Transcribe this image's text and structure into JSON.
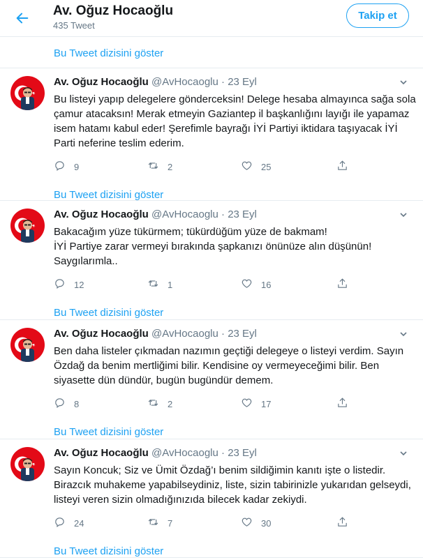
{
  "header": {
    "name": "Av. Oğuz Hocaoğlu",
    "tweet_count": "435 Tweet",
    "follow_label": "Takip et"
  },
  "thread_link_label": "Bu Tweet dizisini göster",
  "tweets": [
    {
      "name": "Av. Oğuz Hocaoğlu",
      "handle": "@AvHocaoglu",
      "separator": "·",
      "date": "23 Eyl",
      "lines": [
        "Bu listeyi yapıp delegelere gönderceksin! Delege hesaba almayınca sağa sola",
        "çamur atacaksın! Merak etmeyin Gaziantep il başkanlığını layığı ile yapamaz",
        "isem hatamı kabul eder! Şerefimle bayrağı İYİ Partiyi iktidara taşıyacak İYİ",
        "Parti neferine teslim ederim."
      ],
      "replies": "9",
      "retweets": "2",
      "likes": "25"
    },
    {
      "name": "Av. Oğuz Hocaoğlu",
      "handle": "@AvHocaoglu",
      "separator": "·",
      "date": "23 Eyl",
      "lines": [
        "Bakacağım yüze tükürmem; tükürdüğüm yüze de bakmam!",
        "İYİ Partiye zarar vermeyi bırakında şapkanızı önünüze alın düşünün!",
        "Saygılarımla.."
      ],
      "replies": "12",
      "retweets": "1",
      "likes": "16"
    },
    {
      "name": "Av. Oğuz Hocaoğlu",
      "handle": "@AvHocaoglu",
      "separator": "·",
      "date": "23 Eyl",
      "lines": [
        "Ben daha listeler çıkmadan nazımın geçtiği delegeye o listeyi verdim. Sayın",
        "Özdağ da benim mertliğimi bilir. Kendisine oy vermeyeceğimi bilir. Ben",
        "siyasette dün dündür, bugün bugündür demem."
      ],
      "replies": "8",
      "retweets": "2",
      "likes": "17"
    },
    {
      "name": "Av. Oğuz Hocaoğlu",
      "handle": "@AvHocaoglu",
      "separator": "·",
      "date": "23 Eyl",
      "lines": [
        "Sayın Koncuk; Siz ve Ümit Özdağ’ı benim sildiğimin kanıtı işte o listedir.",
        "Birazcık muhakeme yapabilseydiniz, liste, sizin tabirinizle yukarıdan gelseydi,",
        "listeyi veren sizin olmadığınızıda bilecek kadar zekiydi."
      ],
      "replies": "24",
      "retweets": "7",
      "likes": "30"
    }
  ],
  "icons": {
    "back": "arrow-left-icon",
    "caret": "chevron-down-icon",
    "reply": "reply-icon",
    "retweet": "retweet-icon",
    "like": "heart-icon",
    "share": "share-icon"
  },
  "colors": {
    "accent": "#1da1f2",
    "muted": "#657786",
    "divider": "#e6ecf0",
    "text": "#14171a"
  }
}
